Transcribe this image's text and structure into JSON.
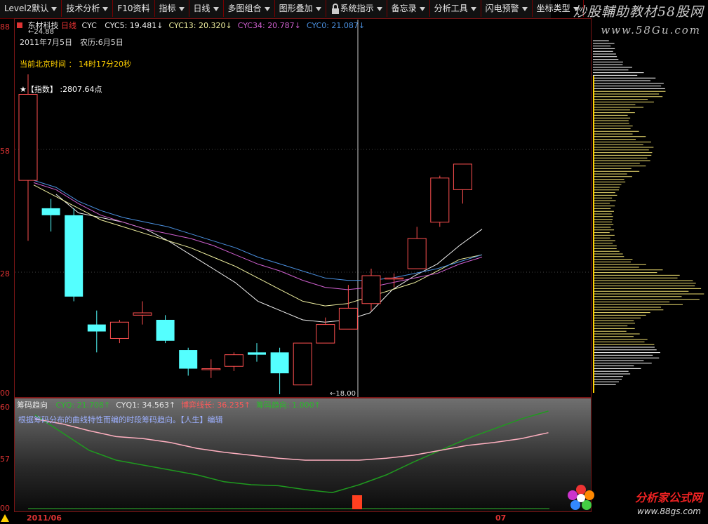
{
  "toolbar": {
    "items": [
      {
        "label": "Level2默认",
        "drop": true
      },
      {
        "label": "技术分析",
        "drop": true
      },
      {
        "label": "F10资料",
        "drop": false
      },
      {
        "label": "指标",
        "drop": true
      },
      {
        "label": "日线",
        "drop": true
      },
      {
        "label": "多图组合",
        "drop": true
      },
      {
        "label": "图形叠加",
        "drop": true
      },
      {
        "label": "系统指示",
        "drop": true
      },
      {
        "label": "备忘录",
        "drop": true
      },
      {
        "label": "分析工具",
        "drop": true
      },
      {
        "label": "闪电预警",
        "drop": true
      },
      {
        "label": "坐标类型",
        "drop": true
      }
    ]
  },
  "brand": {
    "line1": "炒股輔助教材58股网",
    "line2": "www.58Gu.com",
    "line3": "分析家公式网",
    "line4": "www.88gs.com"
  },
  "main": {
    "stock": "东材科技",
    "period": "日线",
    "indicator": "CYC",
    "lines": [
      {
        "label": "CYC5: 19.481↓",
        "color": "#f0f0f0"
      },
      {
        "label": "CYC13: 20.320↓",
        "color": "#f0f0a0"
      },
      {
        "label": "CYC34: 20.787↓",
        "color": "#d060d0"
      },
      {
        "label": "CYC0: 21.087↓",
        "color": "#4a90e0"
      }
    ],
    "high_label": "←24.88",
    "low_label": "←18.00",
    "date_label": "2011年7月5日",
    "lunar_label": "农历:6月5日",
    "time_label": "当前北京时间 ： 14时17分20秒",
    "index_label": "★【指数】 :2807.64点",
    "y_ticks": [
      "88",
      "58",
      "28",
      "00"
    ]
  },
  "sub": {
    "title": "筹码趋向",
    "items": [
      {
        "label": "CYQ: 21.708↑",
        "color": "#2db82d"
      },
      {
        "label": "CYQ1: 34.563↑",
        "color": "#e6e6e6"
      },
      {
        "label": "博弈线长: 36.235↑",
        "color": "#ff5a5a"
      },
      {
        "label": "筹码趋向: 1.000↑",
        "color": "#2db82d"
      }
    ],
    "desc": "根据筹码分布的曲线特性而编的时段筹码趋向。【人生】编辑",
    "y_ticks": [
      "60",
      "57",
      "00"
    ]
  },
  "xaxis": {
    "left_label": "2011/06",
    "right_label": "07"
  },
  "chart_data": {
    "type": "candlestick",
    "price_range": [
      18.0,
      24.88
    ],
    "candles": [
      {
        "o": 22.6,
        "c": 24.45,
        "h": 24.88,
        "l": 21.3
      },
      {
        "o": 22.0,
        "c": 21.85,
        "h": 22.2,
        "l": 21.5
      },
      {
        "o": 21.85,
        "c": 20.1,
        "h": 22.0,
        "l": 20.0
      },
      {
        "o": 19.5,
        "c": 19.35,
        "h": 19.8,
        "l": 18.9
      },
      {
        "o": 19.2,
        "c": 19.55,
        "h": 19.6,
        "l": 19.1
      },
      {
        "o": 19.7,
        "c": 19.75,
        "h": 20.0,
        "l": 19.5
      },
      {
        "o": 19.6,
        "c": 19.15,
        "h": 19.7,
        "l": 19.1
      },
      {
        "o": 18.95,
        "c": 18.55,
        "h": 19.0,
        "l": 18.4
      },
      {
        "o": 18.55,
        "c": 18.55,
        "h": 18.75,
        "l": 18.35
      },
      {
        "o": 18.6,
        "c": 18.85,
        "h": 18.9,
        "l": 18.5
      },
      {
        "o": 18.9,
        "c": 18.85,
        "h": 19.1,
        "l": 18.7
      },
      {
        "o": 18.9,
        "c": 18.45,
        "h": 19.0,
        "l": 18.0
      },
      {
        "o": 18.2,
        "c": 19.1,
        "h": 19.1,
        "l": 18.2
      },
      {
        "o": 19.1,
        "c": 19.5,
        "h": 19.65,
        "l": 19.1
      },
      {
        "o": 19.4,
        "c": 19.85,
        "h": 20.35,
        "l": 19.4
      },
      {
        "o": 19.95,
        "c": 20.55,
        "h": 20.7,
        "l": 19.8
      },
      {
        "o": 20.5,
        "c": 20.5,
        "h": 20.6,
        "l": 20.3
      },
      {
        "o": 20.7,
        "c": 21.35,
        "h": 21.6,
        "l": 20.7
      },
      {
        "o": 21.7,
        "c": 22.65,
        "h": 22.7,
        "l": 21.6
      },
      {
        "o": 22.4,
        "c": 22.95,
        "h": 22.95,
        "l": 22.1
      }
    ],
    "series": [
      {
        "name": "CYC5",
        "color": "#f0f0f0",
        "values": [
          null,
          22.3,
          21.9,
          21.8,
          21.7,
          21.55,
          21.3,
          21.0,
          20.7,
          20.4,
          20.0,
          19.8,
          19.6,
          19.55,
          19.6,
          19.75,
          20.25,
          20.55,
          20.8,
          21.2,
          21.55
        ]
      },
      {
        "name": "CYC13",
        "color": "#f0f0a0",
        "values": [
          22.5,
          22.25,
          22.0,
          21.75,
          21.6,
          21.45,
          21.3,
          21.15,
          20.95,
          20.75,
          20.5,
          20.25,
          20.0,
          19.9,
          19.95,
          20.1,
          20.25,
          20.4,
          20.65,
          20.9,
          21.0
        ]
      },
      {
        "name": "CYC34",
        "color": "#d060d0",
        "values": [
          22.55,
          22.4,
          22.1,
          21.85,
          21.7,
          21.55,
          21.45,
          21.35,
          21.2,
          21.0,
          20.8,
          20.65,
          20.45,
          20.3,
          20.25,
          20.3,
          20.4,
          20.5,
          20.6,
          20.8,
          20.95
        ]
      },
      {
        "name": "CYC0",
        "color": "#4a90e0",
        "values": [
          22.6,
          22.45,
          22.15,
          21.95,
          21.8,
          21.7,
          21.6,
          21.45,
          21.3,
          21.15,
          20.95,
          20.8,
          20.65,
          20.5,
          20.45,
          20.45,
          20.5,
          20.6,
          20.7,
          20.85,
          21.0
        ]
      }
    ],
    "sub_series": [
      {
        "name": "CYQ",
        "color": "#1f9a1f",
        "values": [
          0.96,
          0.78,
          0.6,
          0.5,
          0.45,
          0.4,
          0.35,
          0.28,
          0.25,
          0.24,
          0.2,
          0.17,
          0.25,
          0.35,
          0.48,
          0.6,
          0.72,
          0.82,
          0.92,
          1.0
        ]
      },
      {
        "name": "CYQ1",
        "color": "#ffb0c0",
        "values": [
          0.92,
          0.87,
          0.8,
          0.74,
          0.72,
          0.68,
          0.62,
          0.58,
          0.55,
          0.52,
          0.5,
          0.5,
          0.5,
          0.52,
          0.55,
          0.6,
          0.65,
          0.68,
          0.72,
          0.78
        ]
      }
    ]
  }
}
